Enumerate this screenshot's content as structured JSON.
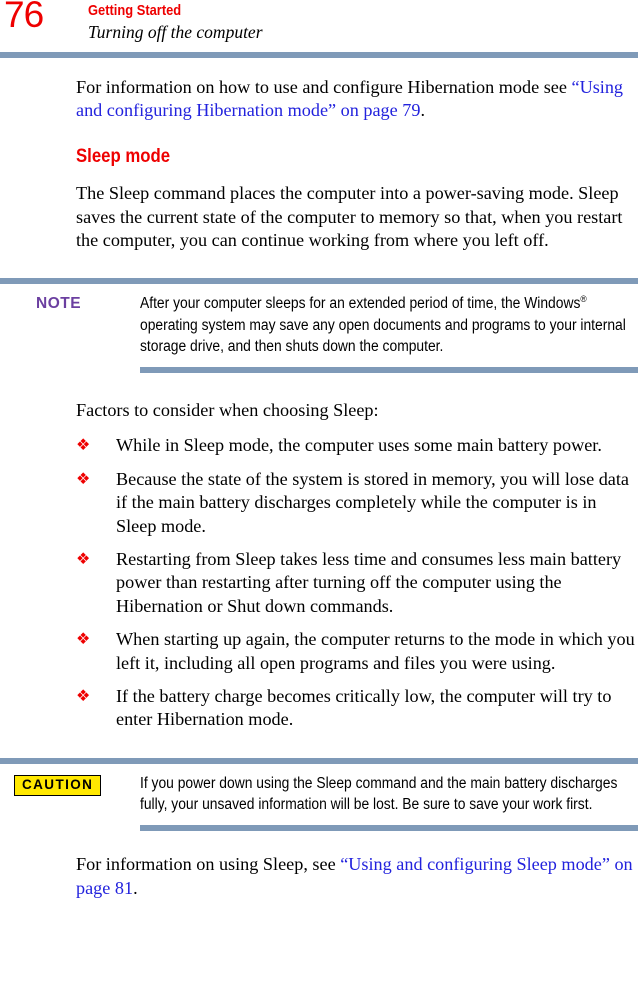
{
  "header": {
    "page_number": "76",
    "chapter": "Getting Started",
    "section": "Turning off the computer"
  },
  "colors": {
    "accent_red": "#ee0000",
    "xref_blue": "#2222dd",
    "rule_blue": "#7f9ab8",
    "note_purple": "#6b3fa0",
    "caution_yellow": "#ffe800"
  },
  "content": {
    "intro_paragraph": {
      "lead": "For information on how to use and configure Hibernation mode see ",
      "link": "“Using and configuring Hibernation mode” on page 79",
      "tail": "."
    },
    "heading_sleep_mode": "Sleep mode",
    "sleep_paragraph": "The Sleep command places the computer into a power-saving mode. Sleep saves the current state of the computer to memory so that, when you restart the computer, you can continue working from where you left off.",
    "note": {
      "label": "NOTE",
      "text_before_reg": "After your computer sleeps for an extended period of time, the Windows",
      "registered_mark": "®",
      "text_after_reg": " operating system may save any open documents and programs to your internal storage drive, and then shuts down the computer."
    },
    "factors_lead_in": "Factors to consider when choosing Sleep:",
    "bullet_glyph": "❖",
    "bullets": [
      "While in Sleep mode, the computer uses some main battery power.",
      "Because the state of the system is stored in memory, you will lose data if the main battery discharges completely while the computer is in Sleep mode.",
      "Restarting from Sleep takes less time and consumes less main battery power than restarting after turning off the computer using the Hibernation or Shut down commands.",
      "When starting up again, the computer returns to the mode in which you left it, including all open programs and files you were using.",
      "If the battery charge becomes critically low, the computer will try to enter Hibernation mode."
    ],
    "caution": {
      "label": "CAUTION",
      "text": "If you power down using the Sleep command and the main battery discharges fully, your unsaved information will be lost. Be sure to save your work first."
    },
    "closing_paragraph": {
      "lead": "For information on using Sleep, see ",
      "link": "“Using and configuring Sleep mode” on page 81",
      "tail": "."
    }
  }
}
